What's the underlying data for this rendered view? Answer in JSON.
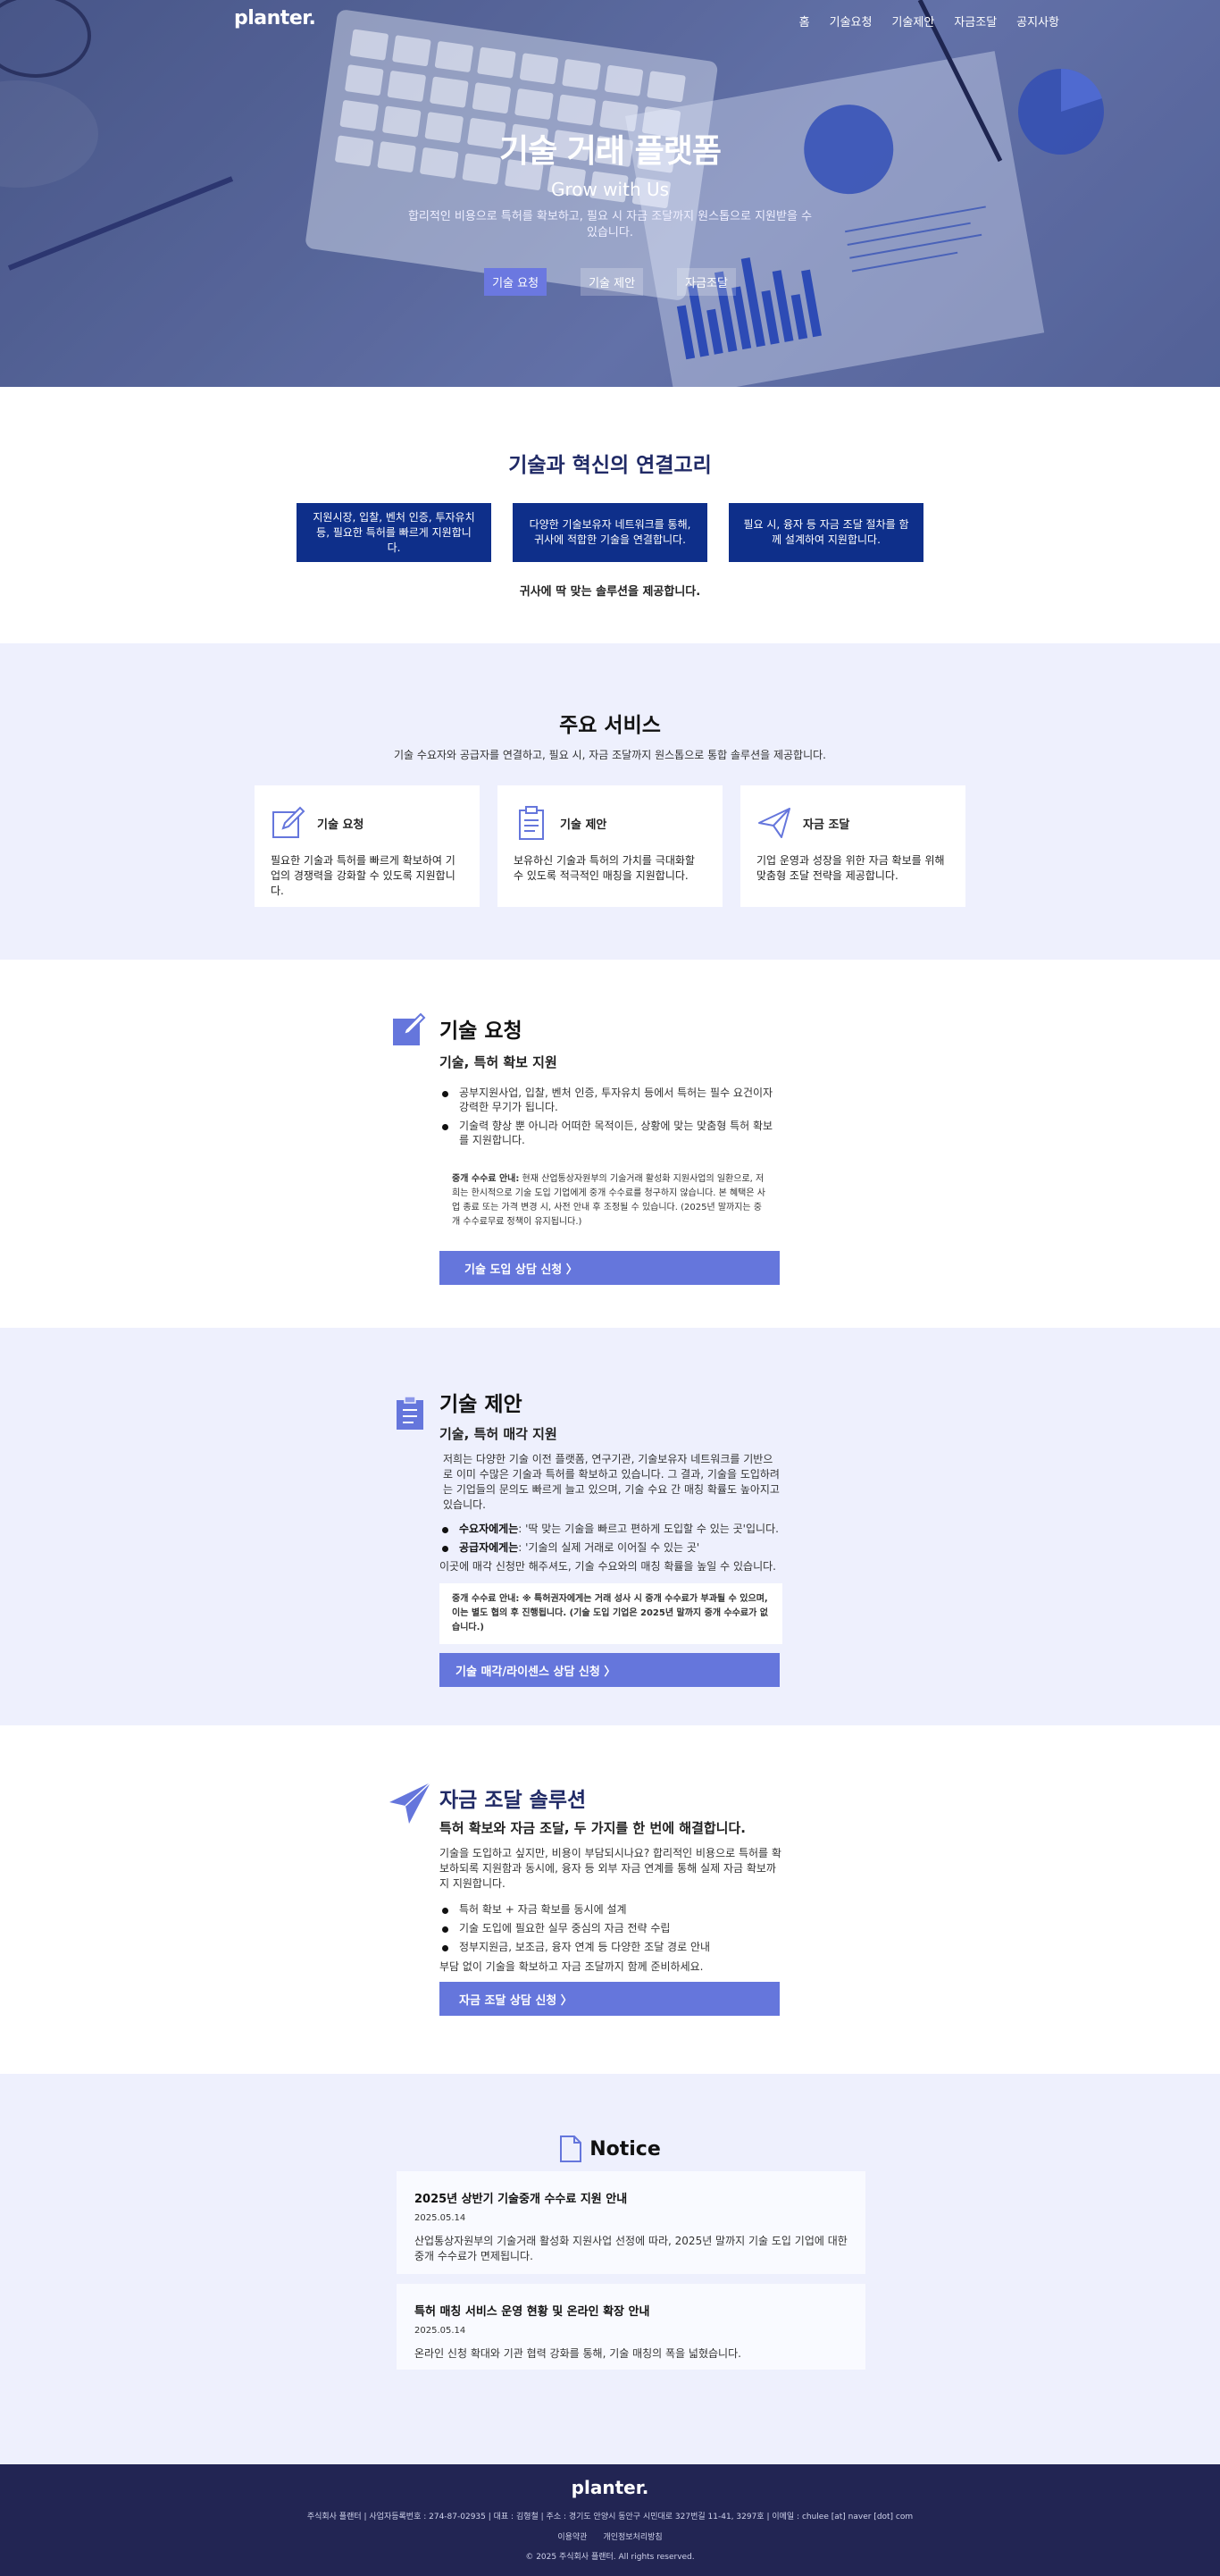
{
  "nav": {
    "logo": "planter.",
    "links": [
      "홈",
      "기술요청",
      "기술제안",
      "자금조달",
      "공지사항"
    ]
  },
  "hero": {
    "title": "기술 거래 플랫폼",
    "subtitle": "Grow with Us",
    "description": "합리적인 비용으로 특허를 확보하고, 필요 시 자금 조달까지 원스톱으로 지원받을 수 있습니다.",
    "buttons": [
      "기술 요청",
      "기술 제안",
      "자금조달"
    ]
  },
  "connect": {
    "title": "기술과 혁신의 연결고리",
    "boxes": [
      "지원시장, 입찰, 벤처 인증, 투자유치 등, 필요한 특허를 빠르게 지원합니다.",
      "다양한 기술보유자 네트워크를 통해, 귀사에 적합한 기술을 연결합니다.",
      "필요 시, 융자 등 자금 조달 절차를 함께 설계하여 지원합니다."
    ],
    "footer": "귀사에 딱 맞는 솔루션을 제공합니다."
  },
  "services": {
    "title": "주요 서비스",
    "description": "기술 수요자와 공급자를 연결하고, 필요 시, 자금 조달까지 원스톱으로 통합 솔루션을 제공합니다.",
    "cards": [
      {
        "icon": "edit-icon",
        "title": "기술 요청",
        "desc": "필요한 기술과 특허를 빠르게 확보하여 기업의 경쟁력을 강화할 수 있도록 지원합니다."
      },
      {
        "icon": "clipboard-icon",
        "title": "기술 제안",
        "desc": "보유하신 기술과 특허의 가치를 극대화할 수 있도록 적극적인 매칭을 지원합니다."
      },
      {
        "icon": "paper-plane-icon",
        "title": "자금 조달",
        "desc": "기업 운영과 성장을 위한 자금 확보를 위해 맞춤형 조달 전략을 제공합니다."
      }
    ]
  },
  "tech_request": {
    "title": "기술 요청",
    "subtitle": "기술, 특허 확보 지원",
    "bullets": [
      "공부지원사업, 입찰, 벤처 인증, 투자유치 등에서 특허는 필수 요건이자 강력한 무기가 됩니다.",
      "기술력 향상 뿐 아니라 어떠한 목적이든, 상황에 맞는 맞춤형 특허 확보를 지원합니다."
    ],
    "note_label": "중개 수수료 안내:",
    "note_text": " 현재 산업통상자원부의 기술거래 활성화 지원사업의 일환으로, 저희는 한시적으로 기술 도입 기업에게 중개 수수료를 청구하지 않습니다. 본 혜택은 사업 종료 또는 가격 변경 시, 사전 안내 후 조정될 수 있습니다. (2025년 말까지는 중개 수수료무료 정책이 유지됩니다.)",
    "cta": "기술 도입 상담 신청 〉"
  },
  "tech_offer": {
    "title": "기술 제안",
    "subtitle": "기술, 특허 매각 지원",
    "intro": "저희는 다양한 기술 이전 플랫폼, 연구기관, 기술보유자 네트워크를 기반으로 이미 수많은 기술과 특허를 확보하고 있습니다. 그 결과, 기술을 도입하려는 기업들의 문의도 빠르게 늘고 있으며, 기술 수요 간 매칭 확률도 높아지고 있습니다.",
    "bullets": [
      {
        "label": "수요자에게는",
        "text": ": '딱 맞는 기술을 빠르고 편하게 도입할 수 있는 곳'입니다."
      },
      {
        "label": "공급자에게는",
        "text": ": '기술의 실제 거래로 이어질 수 있는 곳'"
      }
    ],
    "closing": "이곳에 매각 신청만 해주셔도, 기술 수요와의 매칭 확률을 높일 수 있습니다.",
    "note": "중개 수수료 안내: ※ 특허권자에게는 거래 성사 시 중개 수수료가 부과될 수 있으며, 이는 별도 협의 후 진행됩니다. (기술 도입 기업은 2025년 말까지 중개 수수료가 없습니다.)",
    "cta": "기술 매각/라이센스 상담 신청 〉"
  },
  "funding": {
    "title": "자금 조달 솔루션",
    "subtitle": "특허 확보와 자금 조달, 두 가지를 한 번에 해결합니다.",
    "intro": "기술을 도입하고 싶지만, 비용이 부담되시나요? 합리적인 비용으로 특허를 확보하되록 지원함과 동시에, 융자 등 외부 자금 연계를 통해 실제 자금 확보까지 지원합니다.",
    "bullets": [
      "특허 확보 + 자금 확보를 동시에 설계",
      "기술 도입에 필요한 실무 중심의 자금 전략 수립",
      "정부지원금, 보조금, 융자 연계 등 다양한 조달 경로 안내"
    ],
    "closing": "부담 없이 기술을 확보하고 자금 조달까지 함께 준비하세요.",
    "cta": "자금 조달 상담 신청 〉"
  },
  "notice": {
    "title": "Notice",
    "items": [
      {
        "title": "2025년 상반기 기술중개 수수료 지원 안내",
        "date": "2025.05.14",
        "body": "산업통상자원부의 기술거래 활성화 지원사업 선정에 따라, 2025년 말까지 기술 도입 기업에 대한 중개 수수료가 면제됩니다."
      },
      {
        "title": "특허 매칭 서비스 운영 현황 및 온라인 확장 안내",
        "date": "2025.05.14",
        "body": "온라인 신청 확대와 기관 협력 강화를 통해, 기술 매칭의 폭을 넓혔습니다."
      }
    ]
  },
  "footer": {
    "logo": "planter.",
    "info": "주식회사 플랜터 | 사업자등록번호 : 274-87-02935 | 대표 : 김형철 | 주소 : 경기도 안양시 동안구 시민대로 327번길 11-41, 3297호 | 이메일 : chulee [at] naver [dot] com",
    "links": [
      "이용약관",
      "개인정보처리방침"
    ],
    "copyright": "© 2025 주식회사 플랜터. All rights reserved."
  },
  "colors": {
    "primary": "#6576dc",
    "navy": "#0e2f8a",
    "lavender": "#eef0fd",
    "footer": "#222553"
  }
}
